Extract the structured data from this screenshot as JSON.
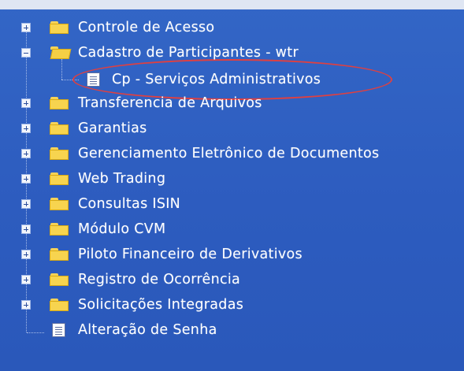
{
  "tree": {
    "items": [
      {
        "label": "Controle de Acesso",
        "icon": "folder-icon",
        "expander": "plus"
      },
      {
        "label": "Cadastro de Participantes - wtr",
        "icon": "folder-open-icon",
        "expander": "minus"
      },
      {
        "label": "Cp - Serviços Administrativos",
        "icon": "document-icon",
        "expander": "none",
        "highlighted": true
      },
      {
        "label": "Transferencia de Arquivos",
        "icon": "folder-icon",
        "expander": "plus"
      },
      {
        "label": "Garantias",
        "icon": "folder-icon",
        "expander": "plus"
      },
      {
        "label": "Gerenciamento Eletrônico de Documentos",
        "icon": "folder-icon",
        "expander": "plus"
      },
      {
        "label": "Web Trading",
        "icon": "folder-icon",
        "expander": "plus"
      },
      {
        "label": "Consultas ISIN",
        "icon": "folder-icon",
        "expander": "plus"
      },
      {
        "label": "Módulo CVM",
        "icon": "folder-icon",
        "expander": "plus"
      },
      {
        "label": "Piloto Financeiro de Derivativos",
        "icon": "folder-icon",
        "expander": "plus"
      },
      {
        "label": "Registro de Ocorrência",
        "icon": "folder-icon",
        "expander": "plus"
      },
      {
        "label": "Solicitações Integradas",
        "icon": "folder-icon",
        "expander": "plus"
      },
      {
        "label": "Alteração de Senha",
        "icon": "document-icon",
        "expander": "none"
      }
    ]
  },
  "colors": {
    "background": "#2f5ec0",
    "highlight_ellipse": "#e04040",
    "folder": "#f7d44f"
  }
}
